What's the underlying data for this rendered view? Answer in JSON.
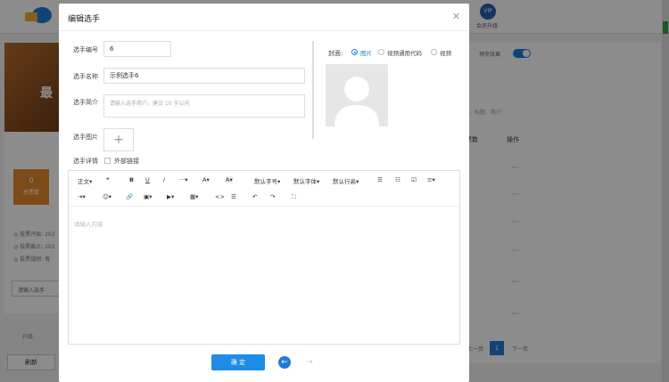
{
  "background": {
    "vip_label": "会员升级",
    "vip_badge": "VIP",
    "banner_text": "最",
    "stat_value": "0",
    "stat_label": "总票数",
    "vote_start": "◎ 投票开始: 202",
    "vote_end": "◎ 投票截止: 202",
    "vote_rule": "◎ 投票规则: 每",
    "search_placeholder": "请输入选手",
    "refresh_button": "刷新",
    "upgrade_label": "升级",
    "preview_label": "预览效果",
    "search_hint": "号、标题、简介",
    "col_count": "票数",
    "col_actions": "操作",
    "row_action": "···",
    "page_prev": "上一页",
    "page_current": "1",
    "page_next": "下一页"
  },
  "modal": {
    "title": "编辑选手",
    "close_icon": "close-icon",
    "fields": {
      "number_label": "选手编号",
      "number_value": "6",
      "name_label": "选手名称",
      "name_value": "示例选手6",
      "intro_label": "选手简介",
      "intro_placeholder": "请输入选手简介，建议 10 字以内",
      "image_label": "选手图片",
      "upload_icon": "plus-icon",
      "detail_label": "选手详情",
      "external_link_label": "外部链接"
    },
    "cover": {
      "label": "封面:",
      "options": [
        "图片",
        "视频通用代码",
        "视频"
      ],
      "selected": "图片"
    },
    "editor": {
      "toolbar": {
        "paragraph": "正文▾",
        "quote": "❝",
        "bold": "B",
        "underline": "U",
        "italic": "I",
        "more": "···▾",
        "font_color": "A▾",
        "bg_color": "A▾",
        "font_size": "默认字号▾",
        "font_family": "默认字体▾",
        "line_height": "默认行高▾",
        "bullet_list": "☰",
        "numbered_list": "☷",
        "todo": "☑",
        "align": "≡▾",
        "indent": "⇥▾",
        "emoji": "☺▾",
        "link": "🔗",
        "image": "▣▾",
        "video": "▶▾",
        "table": "▦▾",
        "code": "<>",
        "divider": "☰",
        "undo": "↶",
        "redo": "↷",
        "fullscreen": "⛶"
      },
      "placeholder": "请输入内容"
    },
    "confirm_button": "确 定",
    "prev_icon": "arrow-left-icon",
    "next_icon": "arrow-right-icon"
  },
  "colors": {
    "primary": "#1f7bd8",
    "accent_orange": "#e3892c"
  }
}
